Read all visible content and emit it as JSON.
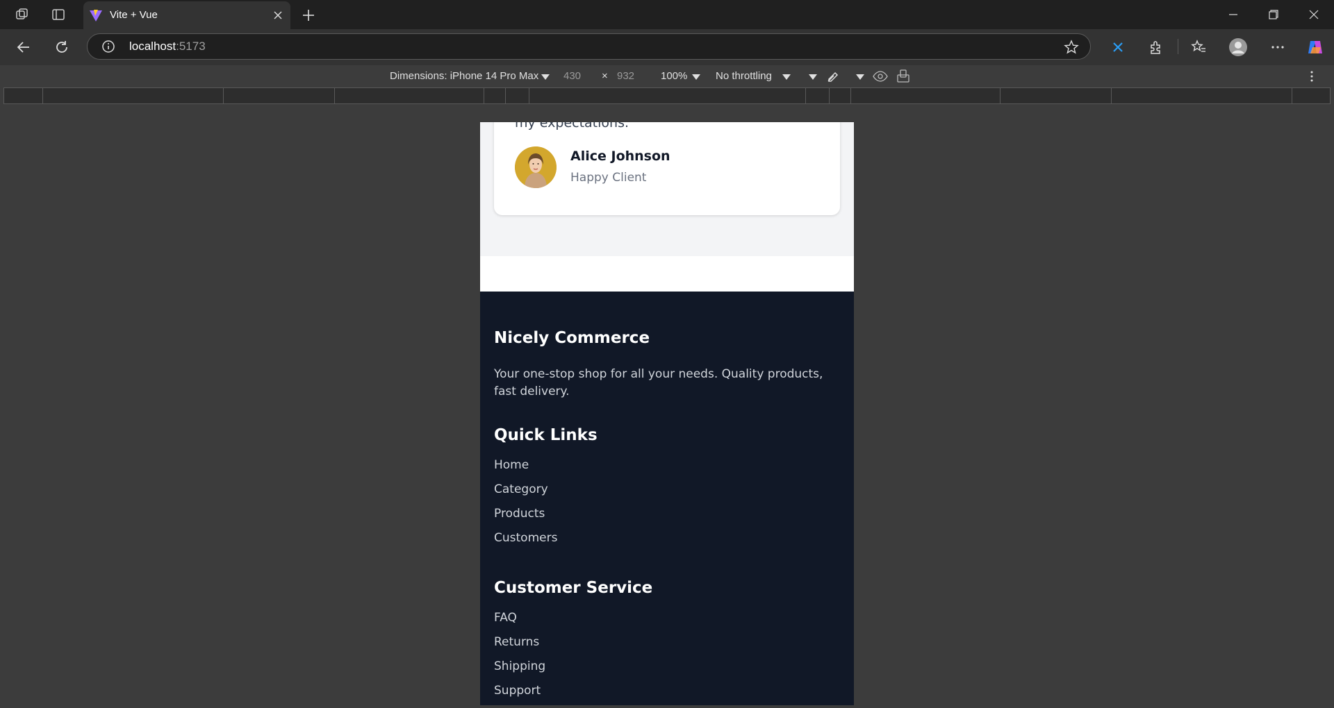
{
  "browser": {
    "tab_title": "Vite + Vue",
    "url_host": "localhost",
    "url_port": ":5173"
  },
  "devtools": {
    "dimensions_label": "Dimensions: iPhone 14 Pro Max",
    "width": "430",
    "times": "×",
    "height": "932",
    "zoom": "100%",
    "throttling": "No throttling"
  },
  "testimonial": {
    "quote_tail": "my expectations.\"",
    "client_name": "Alice Johnson",
    "client_role": "Happy Client"
  },
  "footer": {
    "brand_title": "Nicely Commerce",
    "brand_description": "Your one-stop shop for all your needs. Quality products, fast delivery.",
    "quick_links_title": "Quick Links",
    "quick_links": [
      "Home",
      "Category",
      "Products",
      "Customers"
    ],
    "customer_service_title": "Customer Service",
    "customer_service_links": [
      "FAQ",
      "Returns",
      "Shipping",
      "Support"
    ]
  }
}
